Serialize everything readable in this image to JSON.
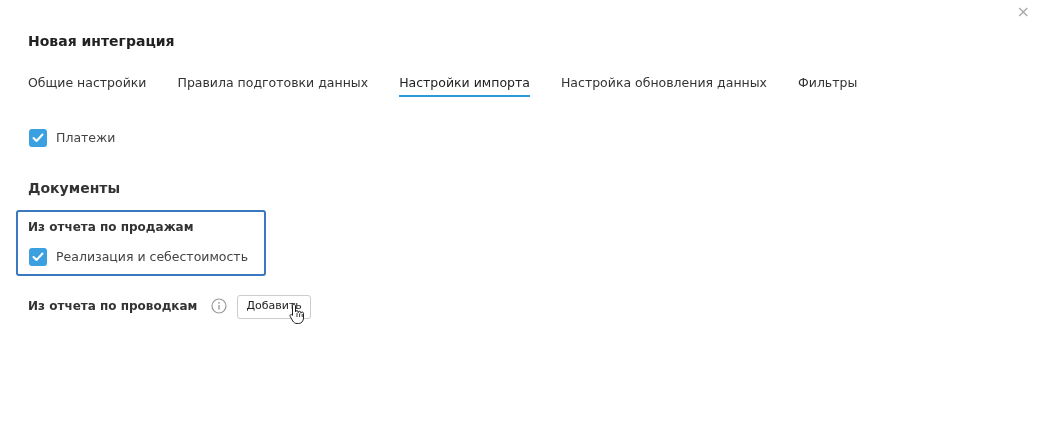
{
  "dialog": {
    "title": "Новая интеграция",
    "close": "×"
  },
  "tabs": [
    {
      "label": "Общие настройки",
      "selected": false
    },
    {
      "label": "Правила подготовки данных",
      "selected": false
    },
    {
      "label": "Настройки импорта",
      "selected": true
    },
    {
      "label": "Настройка обновления данных",
      "selected": false
    },
    {
      "label": "Фильтры",
      "selected": false
    }
  ],
  "payments": {
    "label": "Платежи",
    "checked": true
  },
  "documents": {
    "heading": "Документы",
    "sales_report": {
      "title": "Из отчета по продажам",
      "highlighted": true,
      "options": [
        {
          "label": "Реализация и себестоимость",
          "checked": true
        }
      ]
    },
    "postings_report": {
      "title": "Из отчета по проводкам",
      "button": "Добавить"
    }
  }
}
